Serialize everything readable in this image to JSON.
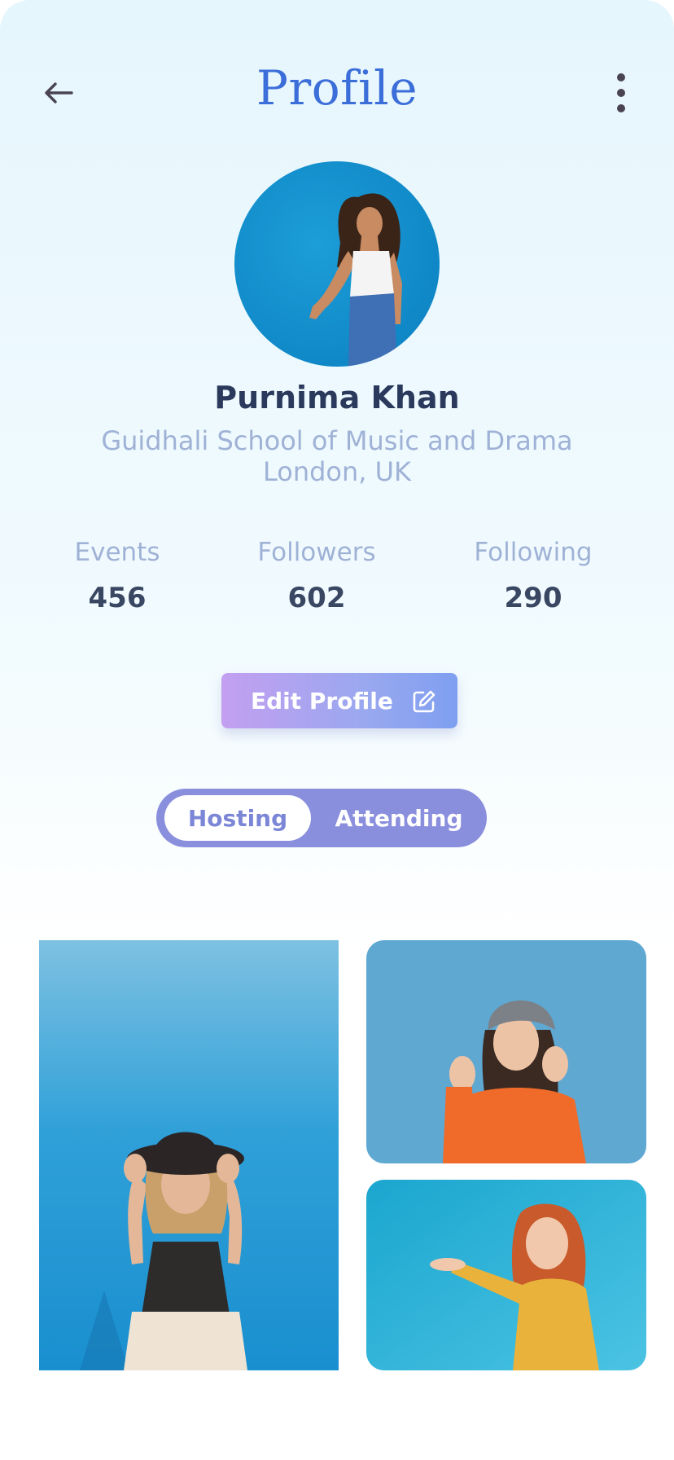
{
  "header": {
    "title": "Profile",
    "back_icon": "arrow-left-icon",
    "menu_icon": "more-vertical-icon"
  },
  "profile": {
    "name": "Purnima Khan",
    "school": "Guidhali School of Music and Drama",
    "location": "London, UK"
  },
  "stats": [
    {
      "label": "Events",
      "value": "456"
    },
    {
      "label": "Followers",
      "value": "602"
    },
    {
      "label": "Following",
      "value": "290"
    }
  ],
  "edit_button": {
    "label": "Edit Profile",
    "icon": "edit-icon"
  },
  "tabs": [
    {
      "label": "Hosting",
      "active": true
    },
    {
      "label": "Attending",
      "active": false
    }
  ],
  "colors": {
    "title": "#3b6ed9",
    "name": "#2b3a5c",
    "muted": "#9fb2d6",
    "segment": "#8a8fdd",
    "button_gradient_start": "#c39ff0",
    "button_gradient_end": "#7f9ff0"
  }
}
